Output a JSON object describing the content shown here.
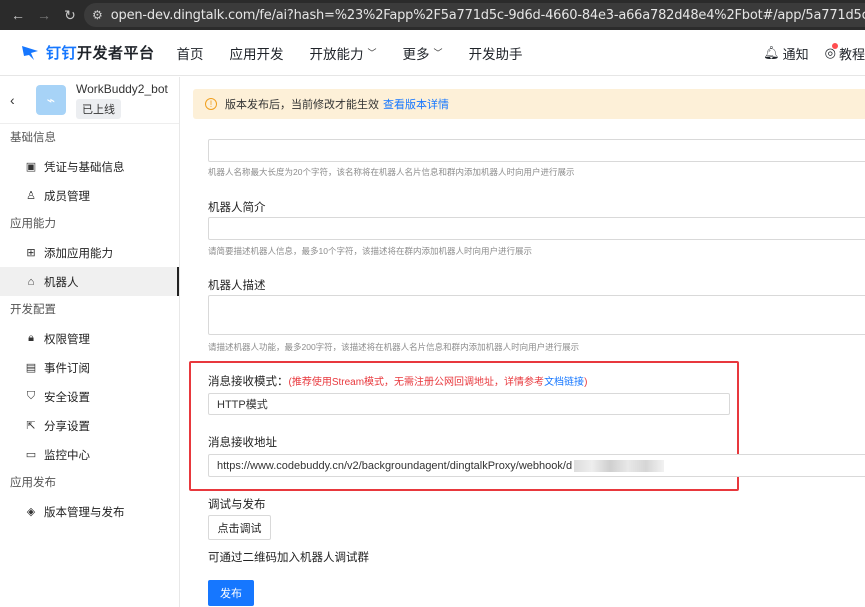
{
  "browser": {
    "url": "open-dev.dingtalk.com/fe/ai?hash=%23%2Fapp%2F5a771d5c-9d6d-4660-84e3-a66a782d48e4%2Fbot#/app/5a771d5c-9d6d-4660-84e3-a66a782d48e4/bot"
  },
  "header": {
    "brand": "钉钉",
    "brand_suffix": "开发者平台",
    "nav": [
      {
        "label": "首页"
      },
      {
        "label": "应用开发"
      },
      {
        "label": "开放能力"
      },
      {
        "label": "更多"
      },
      {
        "label": "开发助手"
      }
    ],
    "notify_label": "通知",
    "tutorial_label": "教程"
  },
  "sidebar": {
    "app_name": "WorkBuddy2_bot",
    "app_status": "已上线",
    "group_basic": "基础信息",
    "item_credentials": "凭证与基础信息",
    "item_members": "成员管理",
    "group_ability": "应用能力",
    "item_add_ability": "添加应用能力",
    "item_robot": "机器人",
    "group_dev": "开发配置",
    "item_permissions": "权限管理",
    "item_events": "事件订阅",
    "item_security": "安全设置",
    "item_share": "分享设置",
    "item_monitor": "监控中心",
    "group_release": "应用发布",
    "item_versions": "版本管理与发布"
  },
  "notice": {
    "text": "版本发布后，当前修改才能生效",
    "link": "查看版本详情"
  },
  "form": {
    "name_hint": "机器人名称最大长度为20个字符，该名称将在机器人名片信息和群内添加机器人时向用户进行展示",
    "intro_label": "机器人简介",
    "intro_hint": "请简要描述机器人信息，最多10个字符，该描述将在群内添加机器人时向用户进行展示",
    "desc_label": "机器人描述",
    "desc_hint": "请描述机器人功能，最多200字符，该描述将在机器人名片信息和群内添加机器人时向用户进行展示",
    "mode_label": "消息接收模式：",
    "mode_note": "(推荐使用Stream模式，无需注册公网回调地址，详情参考",
    "mode_link": "文档链接",
    "mode_note_end": ")",
    "mode_value": "HTTP模式",
    "url_label": "消息接收地址",
    "url_value": "https://www.codebuddy.cn/v2/backgroundagent/dingtalkProxy/webhook/d",
    "debug_label": "调试与发布",
    "debug_button": "点击调试",
    "qr_hint": "可通过二维码加入机器人调试群",
    "publish_button": "发布"
  }
}
